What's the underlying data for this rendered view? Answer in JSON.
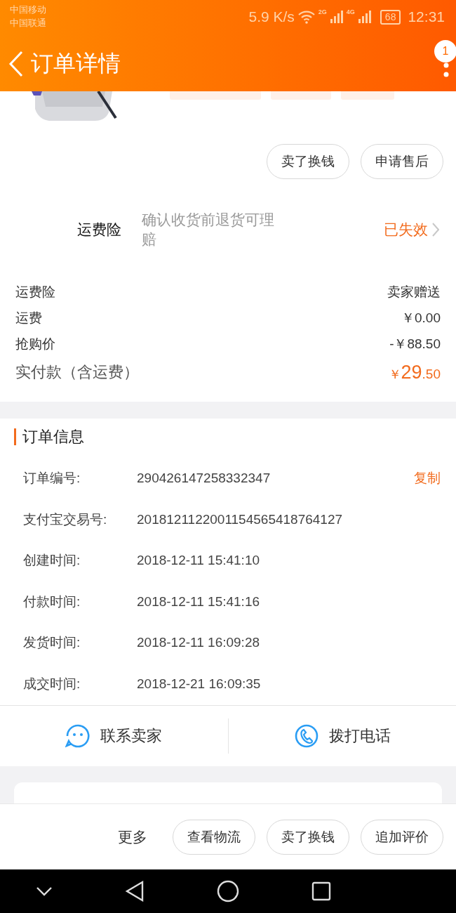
{
  "status_bar": {
    "carriers": [
      "中国移动",
      "中国联通"
    ],
    "speed": "5.9 K/s",
    "networks": [
      "2G",
      "4G"
    ],
    "battery": "68",
    "time": "12:31"
  },
  "header": {
    "title": "订单详情",
    "badge": "1"
  },
  "item_actions": [
    "卖了换钱",
    "申请售后"
  ],
  "insurance": {
    "label": "运费险",
    "description": "确认收货前退货可理赔",
    "status": "已失效"
  },
  "price_rows": [
    {
      "label": "运费险",
      "value": "卖家赠送"
    },
    {
      "label": "运费",
      "value": "￥0.00"
    },
    {
      "label": "抢购价",
      "value": "-￥88.50"
    }
  ],
  "total": {
    "label": "实付款（含运费）",
    "currency": "￥",
    "integer": "29",
    "decimal": ".50"
  },
  "order_info": {
    "title": "订单信息",
    "rows": [
      {
        "label": "订单编号:",
        "value": "290426147258332347",
        "action": "复制"
      },
      {
        "label": "支付宝交易号:",
        "value": "2018121122001154565418764127"
      },
      {
        "label": "创建时间:",
        "value": "2018-12-11 15:41:10"
      },
      {
        "label": "付款时间:",
        "value": "2018-12-11 15:41:16"
      },
      {
        "label": "发货时间:",
        "value": "2018-12-11 16:09:28"
      },
      {
        "label": "成交时间:",
        "value": "2018-12-21 16:09:35"
      }
    ]
  },
  "contact": [
    {
      "kind": "chat",
      "label": "联系卖家"
    },
    {
      "kind": "phone",
      "label": "拨打电话"
    }
  ],
  "bottom_bar": {
    "more": "更多",
    "buttons": [
      "查看物流",
      "卖了换钱",
      "追加评价"
    ]
  }
}
